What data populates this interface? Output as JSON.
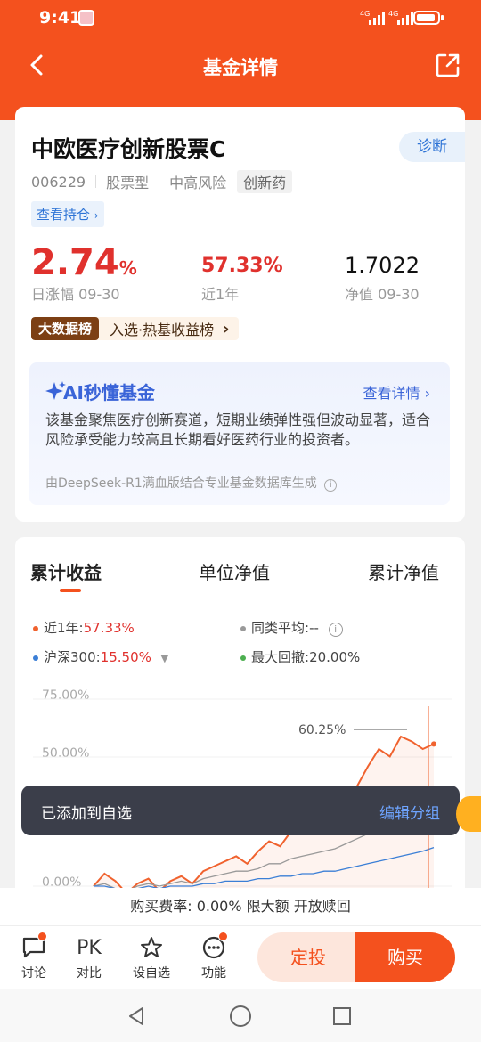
{
  "status_bar": {
    "time": "9:41",
    "sig1": "4G",
    "sig2": "4G"
  },
  "nav": {
    "title": "基金详情"
  },
  "fund": {
    "name": "中欧医疗创新股票C",
    "diagnose_label": "诊断",
    "code": "006229",
    "type": "股票型",
    "risk": "中高风险",
    "tag": "创新药",
    "holdings_label": "查看持仓",
    "daily_change": "2.74",
    "daily_change_unit": "%",
    "daily_change_label": "日涨幅 09-30",
    "year_return": "57.33%",
    "year_return_label": "近1年",
    "nav_value": "1.7022",
    "nav_label": "净值 09-30",
    "rank_badge": "大数据榜",
    "rank_text": "入选·热基收益榜"
  },
  "ai": {
    "title": "AI秒懂基金",
    "link": "查看详情",
    "body": "该基金聚焦医疗创新赛道，短期业绩弹性强但波动显著，适合风险承受能力较高且长期看好医药行业的投资者。",
    "footer": "由DeepSeek-R1满血版结合专业基金数据库生成"
  },
  "chart_section": {
    "tabs": [
      "累计收益",
      "单位净值",
      "累计净值"
    ],
    "active_tab": 0,
    "legend": {
      "fund_label": "近1年:",
      "fund_value": "57.33%",
      "peer_label": "同类平均:",
      "peer_value": "--",
      "index_label": "沪深300:",
      "index_value": "15.50%",
      "drawdown_label": "最大回撤:",
      "drawdown_value": "20.00%"
    },
    "peak_label": "60.25%"
  },
  "chart_data": {
    "type": "line",
    "ylim": [
      -10,
      75
    ],
    "yticks": [
      "75.00%",
      "50.00%",
      "0.00%"
    ],
    "peak_annotation": "60.25%",
    "series": [
      {
        "name": "近1年",
        "color": "#f0622e",
        "values": [
          0,
          5,
          2,
          -3,
          1,
          3,
          -2,
          2,
          4,
          1,
          6,
          8,
          10,
          12,
          9,
          14,
          18,
          16,
          22,
          26,
          24,
          30,
          28,
          35,
          40,
          48,
          55,
          52,
          60,
          58,
          55,
          57
        ]
      },
      {
        "name": "同类平均",
        "color": "#999999",
        "values": [
          0,
          1,
          -1,
          -2,
          0,
          1,
          0,
          1,
          2,
          1,
          3,
          4,
          5,
          6,
          6,
          7,
          9,
          9,
          11,
          12,
          13,
          14,
          15,
          17,
          19,
          21,
          24,
          25,
          27,
          28,
          29,
          30
        ]
      },
      {
        "name": "沪深300",
        "color": "#3b7fd6",
        "values": [
          0,
          0,
          -1,
          -2,
          -1,
          0,
          -1,
          0,
          0,
          0,
          1,
          1,
          2,
          2,
          2,
          3,
          3,
          4,
          4,
          5,
          5,
          6,
          6,
          7,
          8,
          9,
          10,
          11,
          12,
          13,
          14,
          15.5
        ]
      }
    ]
  },
  "toast": {
    "text": "已添加到自选",
    "action": "编辑分组"
  },
  "fee": {
    "text": "购买费率: 0.00% 限大额 开放赎回"
  },
  "bottom_bar": {
    "discuss": "讨论",
    "compare_icon_text": "PK",
    "compare": "对比",
    "watchlist": "设自选",
    "functions": "功能",
    "sip": "定投",
    "buy": "购买"
  },
  "colors": {
    "brand": "#f4511e",
    "up": "#e0312d",
    "link": "#2e74d6"
  }
}
